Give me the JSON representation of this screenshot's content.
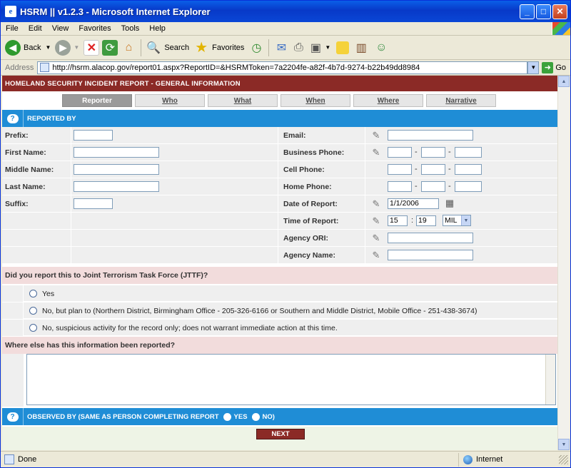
{
  "window": {
    "title": "HSRM || v1.2.3 - Microsoft Internet Explorer"
  },
  "menu": [
    "File",
    "Edit",
    "View",
    "Favorites",
    "Tools",
    "Help"
  ],
  "toolbar": {
    "back": "Back",
    "search": "Search",
    "favorites": "Favorites"
  },
  "address": {
    "label": "Address",
    "url": "http://hsrm.alacop.gov/report01.aspx?ReportID=&HSRMToken=7a2204fe-a82f-4b7d-9274-b22b49dd8984",
    "go": "Go"
  },
  "status": {
    "text": "Done",
    "zone": "Internet"
  },
  "page": {
    "header": "HOMELAND SECURITY INCIDENT REPORT - GENERAL INFORMATION",
    "tabs": [
      "Reporter",
      "Who",
      "What",
      "When",
      "Where",
      "Narrative"
    ],
    "reported_by_title": "REPORTED BY",
    "left_fields": [
      {
        "label": "Prefix:",
        "value": ""
      },
      {
        "label": "First Name:",
        "value": ""
      },
      {
        "label": "Middle Name:",
        "value": ""
      },
      {
        "label": "Last Name:",
        "value": ""
      },
      {
        "label": "Suffix:",
        "value": ""
      }
    ],
    "right_labels": {
      "email": "Email:",
      "business_phone": "Business Phone:",
      "cell_phone": "Cell Phone:",
      "home_phone": "Home Phone:",
      "date_of_report": "Date of Report:",
      "time_of_report": "Time of Report:",
      "agency_ori": "Agency ORI:",
      "agency_name": "Agency Name:"
    },
    "date_value": "1/1/2006",
    "time_hour": "15",
    "time_sep": ":",
    "time_min": "19",
    "time_format": "MIL",
    "phone_dash": "-",
    "jttf_question": "Did you report this to Joint Terrorism Task Force (JTTF)?",
    "jttf_options": [
      "Yes",
      "No, but plan to (Northern District, Birmingham Office - 205-326-6166 or Southern and Middle District, Mobile Office - 251-438-3674)",
      "No, suspicious activity for the record only; does not warrant immediate action at this time."
    ],
    "where_else_question": "Where else has this information been reported?",
    "observed_by_title": "OBSERVED BY (SAME AS PERSON COMPLETING REPORT",
    "observed_yes": "YES",
    "observed_no": "NO)",
    "next_label": "NEXT"
  },
  "colors": {
    "header": "#8b2a26",
    "section": "#1f8dd6",
    "pink": "#f2dcdc",
    "row": "#efefef"
  }
}
